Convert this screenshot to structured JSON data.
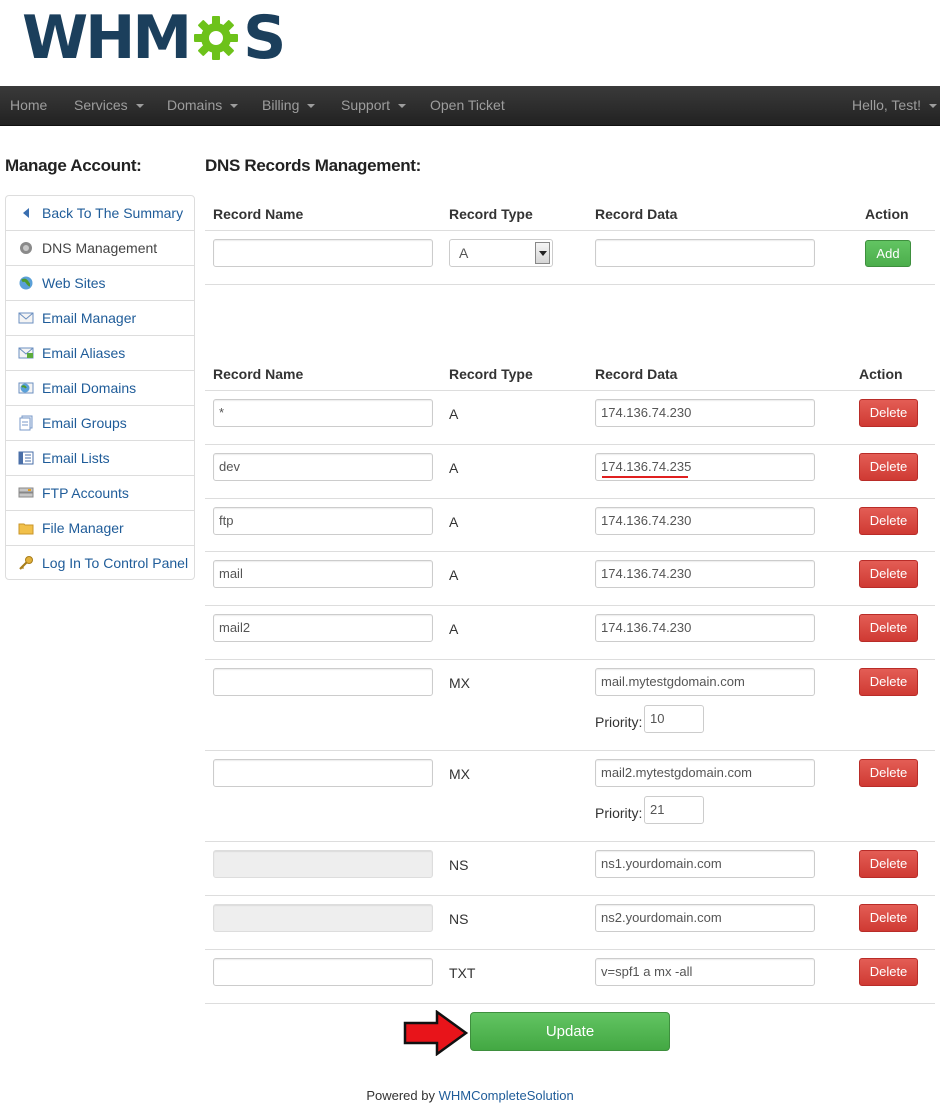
{
  "brand": {
    "logo_text_left": "WHM",
    "logo_text_right": "S",
    "gear_color": "#6dc21a",
    "text_color": "#1b3f5c"
  },
  "navbar": {
    "items": [
      {
        "label": "Home",
        "has_caret": false
      },
      {
        "label": "Services",
        "has_caret": true
      },
      {
        "label": "Domains",
        "has_caret": true
      },
      {
        "label": "Billing",
        "has_caret": true
      },
      {
        "label": "Support",
        "has_caret": true
      },
      {
        "label": "Open Ticket",
        "has_caret": false
      }
    ],
    "user_menu": "Hello, Test!"
  },
  "sidebar": {
    "title": "Manage Account:",
    "items": [
      {
        "label": "Back To The Summary",
        "icon": "triangle-left-icon",
        "active": false
      },
      {
        "label": "DNS Management",
        "icon": "globe-gear-icon",
        "active": true
      },
      {
        "label": "Web Sites",
        "icon": "globe-icon",
        "active": false
      },
      {
        "label": "Email Manager",
        "icon": "envelope-icon",
        "active": false
      },
      {
        "label": "Email Aliases",
        "icon": "envelope-image-icon",
        "active": false
      },
      {
        "label": "Email Domains",
        "icon": "envelope-globe-icon",
        "active": false
      },
      {
        "label": "Email Groups",
        "icon": "document-stack-icon",
        "active": false
      },
      {
        "label": "Email Lists",
        "icon": "list-icon",
        "active": false
      },
      {
        "label": "FTP Accounts",
        "icon": "server-icon",
        "active": false
      },
      {
        "label": "File Manager",
        "icon": "folder-icon",
        "active": false
      },
      {
        "label": "Log In To Control Panel",
        "icon": "key-icon",
        "active": false
      }
    ]
  },
  "main": {
    "title": "DNS Records Management:",
    "headers": {
      "name": "Record Name",
      "type": "Record Type",
      "data": "Record Data",
      "action": "Action"
    },
    "new_record": {
      "name": "",
      "type": "A",
      "data": "",
      "add_label": "Add"
    },
    "delete_label": "Delete",
    "priority_label": "Priority:",
    "records": [
      {
        "name": "*",
        "type": "A",
        "data": "174.136.74.230",
        "priority": null,
        "disabled": false
      },
      {
        "name": "dev",
        "type": "A",
        "data": "174.136.74.235",
        "priority": null,
        "disabled": false
      },
      {
        "name": "ftp",
        "type": "A",
        "data": "174.136.74.230",
        "priority": null,
        "disabled": false
      },
      {
        "name": "mail",
        "type": "A",
        "data": "174.136.74.230",
        "priority": null,
        "disabled": false
      },
      {
        "name": "mail2",
        "type": "A",
        "data": "174.136.74.230",
        "priority": null,
        "disabled": false
      },
      {
        "name": "",
        "type": "MX",
        "data": "mail.mytestgdomain.com",
        "priority": "10",
        "disabled": false
      },
      {
        "name": "",
        "type": "MX",
        "data": "mail2.mytestgdomain.com",
        "priority": "21",
        "disabled": false
      },
      {
        "name": "",
        "type": "NS",
        "data": "ns1.yourdomain.com",
        "priority": null,
        "disabled": true
      },
      {
        "name": "",
        "type": "NS",
        "data": "ns2.yourdomain.com",
        "priority": null,
        "disabled": true
      },
      {
        "name": "",
        "type": "TXT",
        "data": "v=spf1 a mx -all",
        "priority": null,
        "disabled": false
      }
    ],
    "update_label": "Update"
  },
  "footer": {
    "prefix": "Powered by ",
    "link": "WHMCompleteSolution"
  },
  "colors": {
    "link": "#1f5c99",
    "success": "#5cb85c",
    "danger": "#d9534f",
    "navbar": "#222222",
    "annotation": "#e02020"
  }
}
